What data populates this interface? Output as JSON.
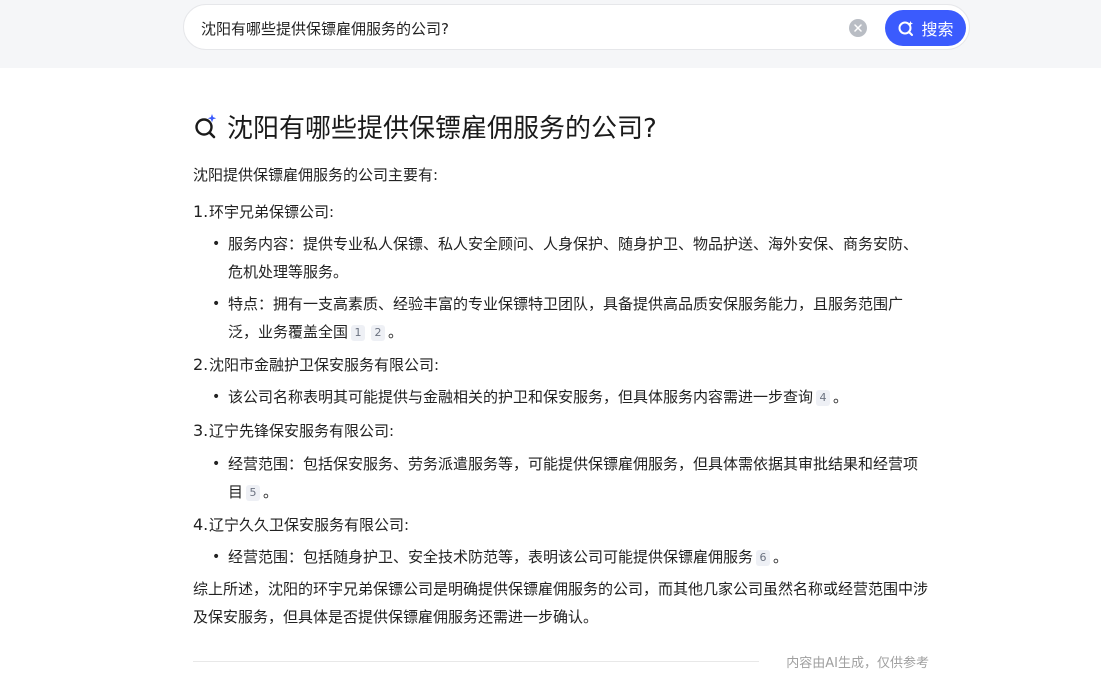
{
  "search": {
    "query": "沈阳有哪些提供保镖雇佣服务的公司?",
    "button_label": "搜索"
  },
  "answer": {
    "title": "沈阳有哪些提供保镖雇佣服务的公司?",
    "intro": "沈阳提供保镖雇佣服务的公司主要有:",
    "companies": [
      {
        "num": "1.",
        "name": "环宇兄弟保镖公司:",
        "bullets": [
          {
            "text": "服务内容：提供专业私人保镖、私人安全顾问、人身保护、随身护卫、物品护送、海外安保、商务安防、危机处理等服务。",
            "cites": []
          },
          {
            "text": "特点：拥有一支高素质、经验丰富的专业保镖特卫团队，具备提供高品质安保服务能力，且服务范围广泛，业务覆盖全国",
            "cites": [
              "1",
              "2"
            ],
            "end": "。"
          }
        ]
      },
      {
        "num": "2.",
        "name": "沈阳市金融护卫保安服务有限公司:",
        "bullets": [
          {
            "text": "该公司名称表明其可能提供与金融相关的护卫和保安服务，但具体服务内容需进一步查询",
            "cites": [
              "4"
            ],
            "end": "。"
          }
        ]
      },
      {
        "num": "3.",
        "name": "辽宁先锋保安服务有限公司:",
        "bullets": [
          {
            "text": "经营范围：包括保安服务、劳务派遣服务等，可能提供保镖雇佣服务，但具体需依据其审批结果和经营项目",
            "cites": [
              "5"
            ],
            "end": "。"
          }
        ]
      },
      {
        "num": "4.",
        "name": "辽宁久久卫保安服务有限公司:",
        "bullets": [
          {
            "text": "经营范围：包括随身护卫、安全技术防范等，表明该公司可能提供保镖雇佣服务",
            "cites": [
              "6"
            ],
            "end": "。"
          }
        ]
      }
    ],
    "summary": "综上所述，沈阳的环宇兄弟保镖公司是明确提供保镖雇佣服务的公司，而其他几家公司虽然名称或经营范围中涉及保安服务，但具体是否提供保镖雇佣服务还需进一步确认。",
    "footer_note": "内容由AI生成，仅供参考"
  },
  "icons": {
    "search_button": "ai-search-icon",
    "clear": "clear-icon",
    "title": "ai-search-sparkle-icon"
  },
  "colors": {
    "accent": "#3b5bfd",
    "page_background": "#f5f6f8"
  }
}
